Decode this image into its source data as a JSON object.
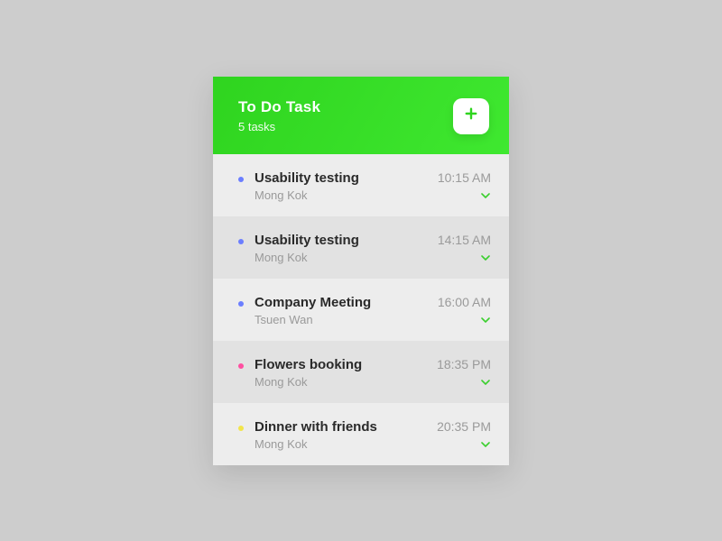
{
  "header": {
    "title": "To Do Task",
    "subtitle": "5 tasks"
  },
  "colors": {
    "accent": "#2fd41f",
    "bullet_blue": "#6b7eff",
    "bullet_pink": "#ff4fa1",
    "bullet_yellow": "#f2e54b",
    "chevron": "#3bcf2e"
  },
  "tasks": [
    {
      "title": "Usability testing",
      "location": "Mong Kok",
      "time": "10:15 AM",
      "bullet": "#6b7eff"
    },
    {
      "title": "Usability testing",
      "location": "Mong Kok",
      "time": "14:15 AM",
      "bullet": "#6b7eff"
    },
    {
      "title": "Company Meeting",
      "location": "Tsuen Wan",
      "time": "16:00 AM",
      "bullet": "#6b7eff"
    },
    {
      "title": "Flowers booking",
      "location": "Mong Kok",
      "time": "18:35 PM",
      "bullet": "#ff4fa1"
    },
    {
      "title": "Dinner with friends",
      "location": "Mong Kok",
      "time": "20:35 PM",
      "bullet": "#f2e54b"
    }
  ]
}
